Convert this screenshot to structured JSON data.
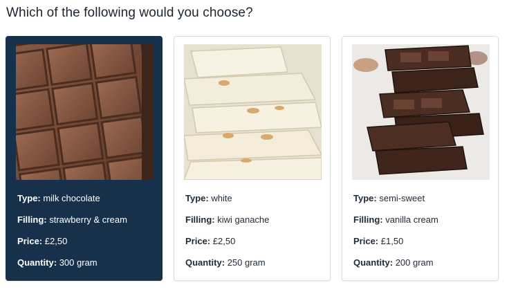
{
  "question": "Which of the following would you choose?",
  "labels": {
    "type": "Type:",
    "filling": "Filling:",
    "price": "Price:",
    "quantity": "Quantity:"
  },
  "options": [
    {
      "type": "milk chocolate",
      "filling": "strawberry & cream",
      "price": "£2,50",
      "quantity": "300 gram",
      "selected": true,
      "image": "milk-chocolate-bar-photo"
    },
    {
      "type": "white",
      "filling": "kiwi ganache",
      "price": "£2,50",
      "quantity": "250 gram",
      "selected": false,
      "image": "white-chocolate-pieces-photo"
    },
    {
      "type": "semi-sweet",
      "filling": "vanilla cream",
      "price": "£1,50",
      "quantity": "200 gram",
      "selected": false,
      "image": "dark-chocolate-stack-photo"
    }
  ],
  "colors": {
    "selected_card_bg": "#163149",
    "card_border": "#d9dde3",
    "text": "#1f2a37"
  }
}
